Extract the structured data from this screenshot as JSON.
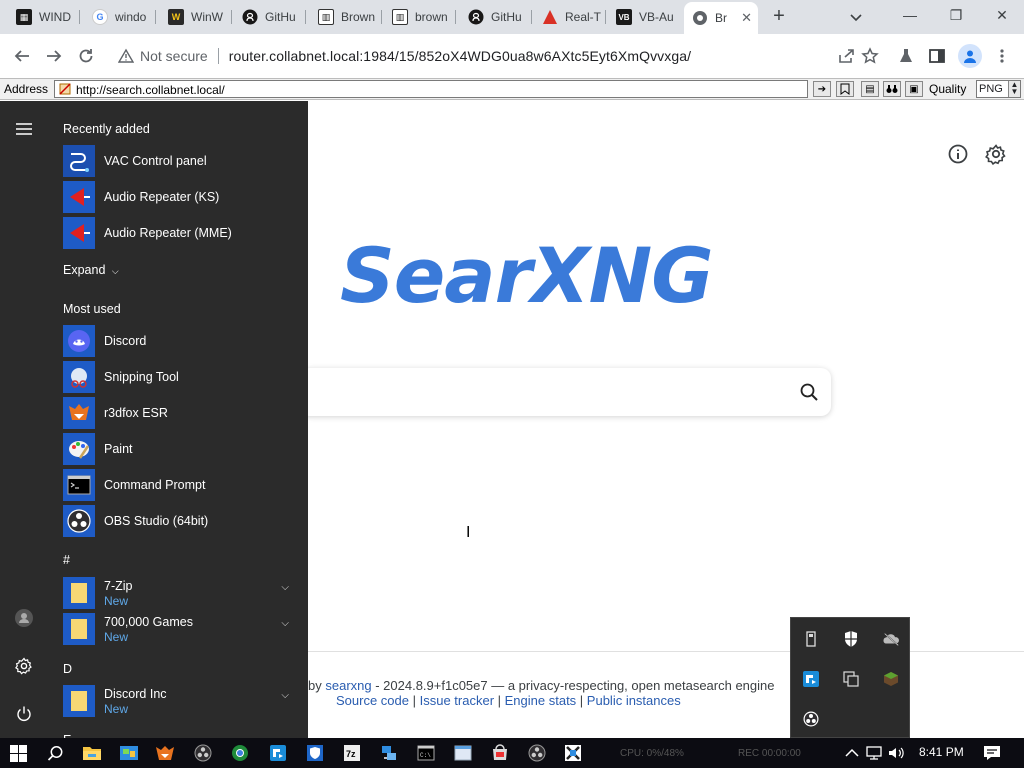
{
  "tabs": [
    {
      "title": "WIND",
      "icon": "book-icon",
      "color": "#1a1a1a"
    },
    {
      "title": "windo",
      "icon": "google-icon",
      "color": "#4285f4"
    },
    {
      "title": "WinW",
      "icon": "w-logo-icon",
      "color": "#2a2a2a"
    },
    {
      "title": "GitHu",
      "icon": "github-icon",
      "color": "#181717"
    },
    {
      "title": "Brown",
      "icon": "archive-icon",
      "color": "#222"
    },
    {
      "title": "brown",
      "icon": "archive-icon",
      "color": "#222"
    },
    {
      "title": "GitHu",
      "icon": "github-icon",
      "color": "#181717"
    },
    {
      "title": "Real-T",
      "icon": "warning-triangle-icon",
      "color": "#d93025"
    },
    {
      "title": "VB-Au",
      "icon": "vb-logo-icon",
      "color": "#1a1a1a"
    },
    {
      "title": "Br",
      "icon": "globe-icon",
      "color": "#5f6368"
    }
  ],
  "omnibox": {
    "security": "Not secure",
    "url": "router.collabnet.local:1984/15/852oX4WDG0ua8w6AXtc5Eyt6XmQvvxga/"
  },
  "address_bar": {
    "label": "Address",
    "value": "http://search.collabnet.local/",
    "quality_label": "Quality",
    "quality_value": "PNG"
  },
  "page": {
    "logo": "SearXNG",
    "footer_prefix": "by",
    "footer_link": "searxng",
    "footer_rest": " - 2024.8.9+f1c05e7 — a privacy-respecting, open metasearch engine",
    "links": [
      "Source code",
      "Issue tracker",
      "Engine stats",
      "Public instances"
    ],
    "separator": " | "
  },
  "start_menu": {
    "recently_added_heading": "Recently added",
    "recently_added": [
      {
        "label": "VAC Control panel",
        "icon": "vac-icon"
      },
      {
        "label": "Audio Repeater (KS)",
        "icon": "audio-repeater-icon"
      },
      {
        "label": "Audio Repeater (MME)",
        "icon": "audio-repeater-icon"
      }
    ],
    "expand_label": "Expand",
    "most_used_heading": "Most used",
    "most_used": [
      {
        "label": "Discord",
        "icon": "discord-icon"
      },
      {
        "label": "Snipping Tool",
        "icon": "snipping-tool-icon"
      },
      {
        "label": "r3dfox ESR",
        "icon": "r3dfox-icon"
      },
      {
        "label": "Paint",
        "icon": "paint-icon"
      },
      {
        "label": "Command Prompt",
        "icon": "command-prompt-icon"
      },
      {
        "label": "OBS Studio (64bit)",
        "icon": "obs-icon"
      }
    ],
    "group_hash": "#",
    "hash_items": [
      {
        "label": "7-Zip",
        "sub": "New",
        "icon": "folder-icon"
      },
      {
        "label": "700,000 Games",
        "sub": "New",
        "icon": "folder-icon"
      }
    ],
    "group_d": "D",
    "d_items": [
      {
        "label": "Discord Inc",
        "sub": "New",
        "icon": "folder-icon"
      }
    ],
    "group_e": "E"
  },
  "taskbar": {
    "clock": "8:41 PM",
    "faded1": "CPU: 0%/48%",
    "faded2": "REC 00:00:00"
  },
  "colors": {
    "logo": "#3a7ad9",
    "start_bg": "#2b2b2b",
    "link": "#2a5db0",
    "taskbar": "#0c0c12",
    "new_badge": "#5fa8e8"
  }
}
